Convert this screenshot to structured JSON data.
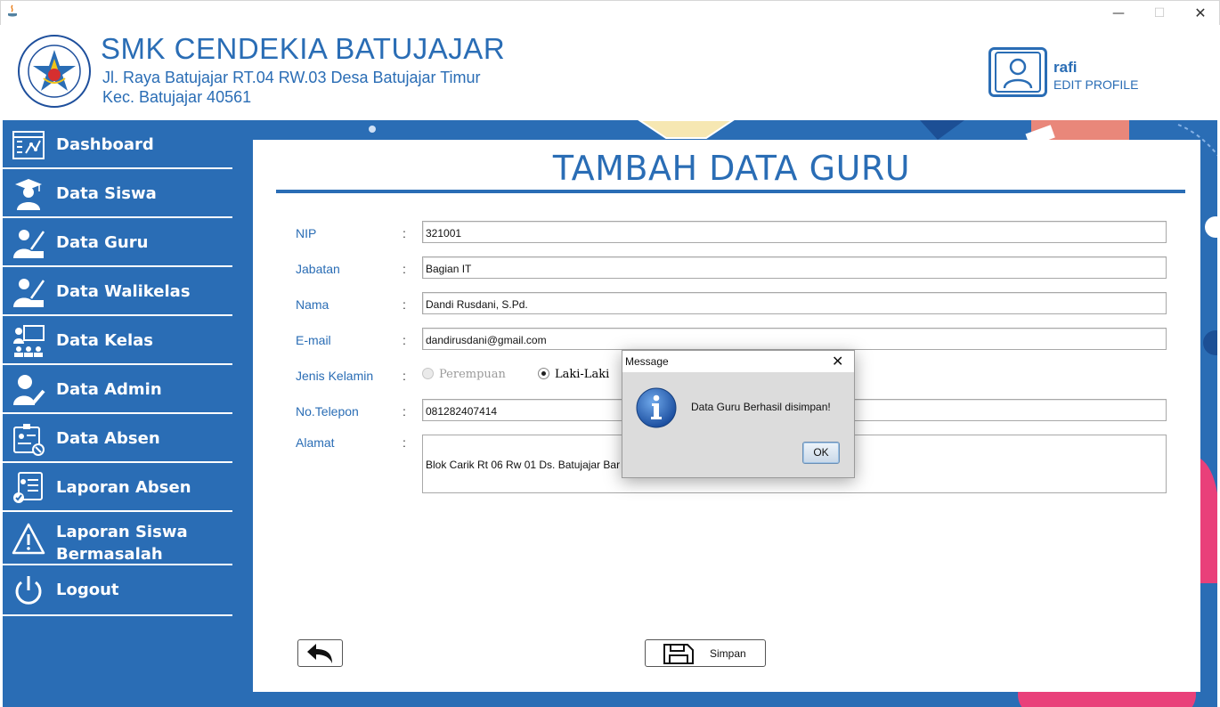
{
  "window": {
    "minimize_glyph": "—",
    "maximize_glyph": "☐",
    "close_glyph": "✕"
  },
  "header": {
    "school_name": "SMK CENDEKIA BATUJAJAR",
    "address_line1": "Jl. Raya Batujajar RT.04 RW.03 Desa Batujajar Timur",
    "address_line2": "Kec. Batujajar 40561",
    "logo_top_text": "SMK CENDEKIA BATUJAJAR",
    "logo_bottom_text": "YAYASAN PUTRA CENDEKIA",
    "profile_name": "rafi",
    "profile_edit": "EDIT PROFILE"
  },
  "sidebar": {
    "items": [
      {
        "label": "Dashboard",
        "icon": "dashboard-icon"
      },
      {
        "label": "Data Siswa",
        "icon": "student-icon"
      },
      {
        "label": "Data Guru",
        "icon": "teacher-icon"
      },
      {
        "label": "Data Walikelas",
        "icon": "homeroom-teacher-icon"
      },
      {
        "label": "Data Kelas",
        "icon": "classroom-icon"
      },
      {
        "label": "Data Admin",
        "icon": "admin-icon"
      },
      {
        "label": "Data Absen",
        "icon": "attendance-icon"
      },
      {
        "label": "Laporan Absen",
        "icon": "report-icon"
      },
      {
        "label": "Laporan Siswa Bermasalah",
        "icon": "warning-icon"
      },
      {
        "label": "Logout",
        "icon": "power-icon"
      }
    ]
  },
  "form": {
    "title": "TAMBAH DATA GURU",
    "colon": ":",
    "nip_label": "NIP",
    "nip_value": "321001",
    "jabatan_label": "Jabatan",
    "jabatan_value": "Bagian IT",
    "nama_label": "Nama",
    "nama_value": "Dandi Rusdani, S.Pd.",
    "email_label": "E-mail",
    "email_value": "dandirusdani@gmail.com",
    "gender_label": "Jenis Kelamin",
    "gender_option_female": "Perempuan",
    "gender_option_male": "Laki-Laki",
    "gender_selected": "Laki-Laki",
    "telepon_label": "No.Telepon",
    "telepon_value": "081282407414",
    "alamat_label": "Alamat",
    "alamat_value": "Blok Carik Rt 06 Rw 01 Ds. Batujajar Bar",
    "save_label": "Simpan"
  },
  "dialog": {
    "title": "Message",
    "message": "Data Guru Berhasil disimpan!",
    "ok_label": "OK",
    "icon": "info-icon"
  },
  "colors": {
    "accent": "#2a6db5",
    "sidebar_bg": "#2a6db5",
    "dialog_bg": "#dcdcdc"
  }
}
